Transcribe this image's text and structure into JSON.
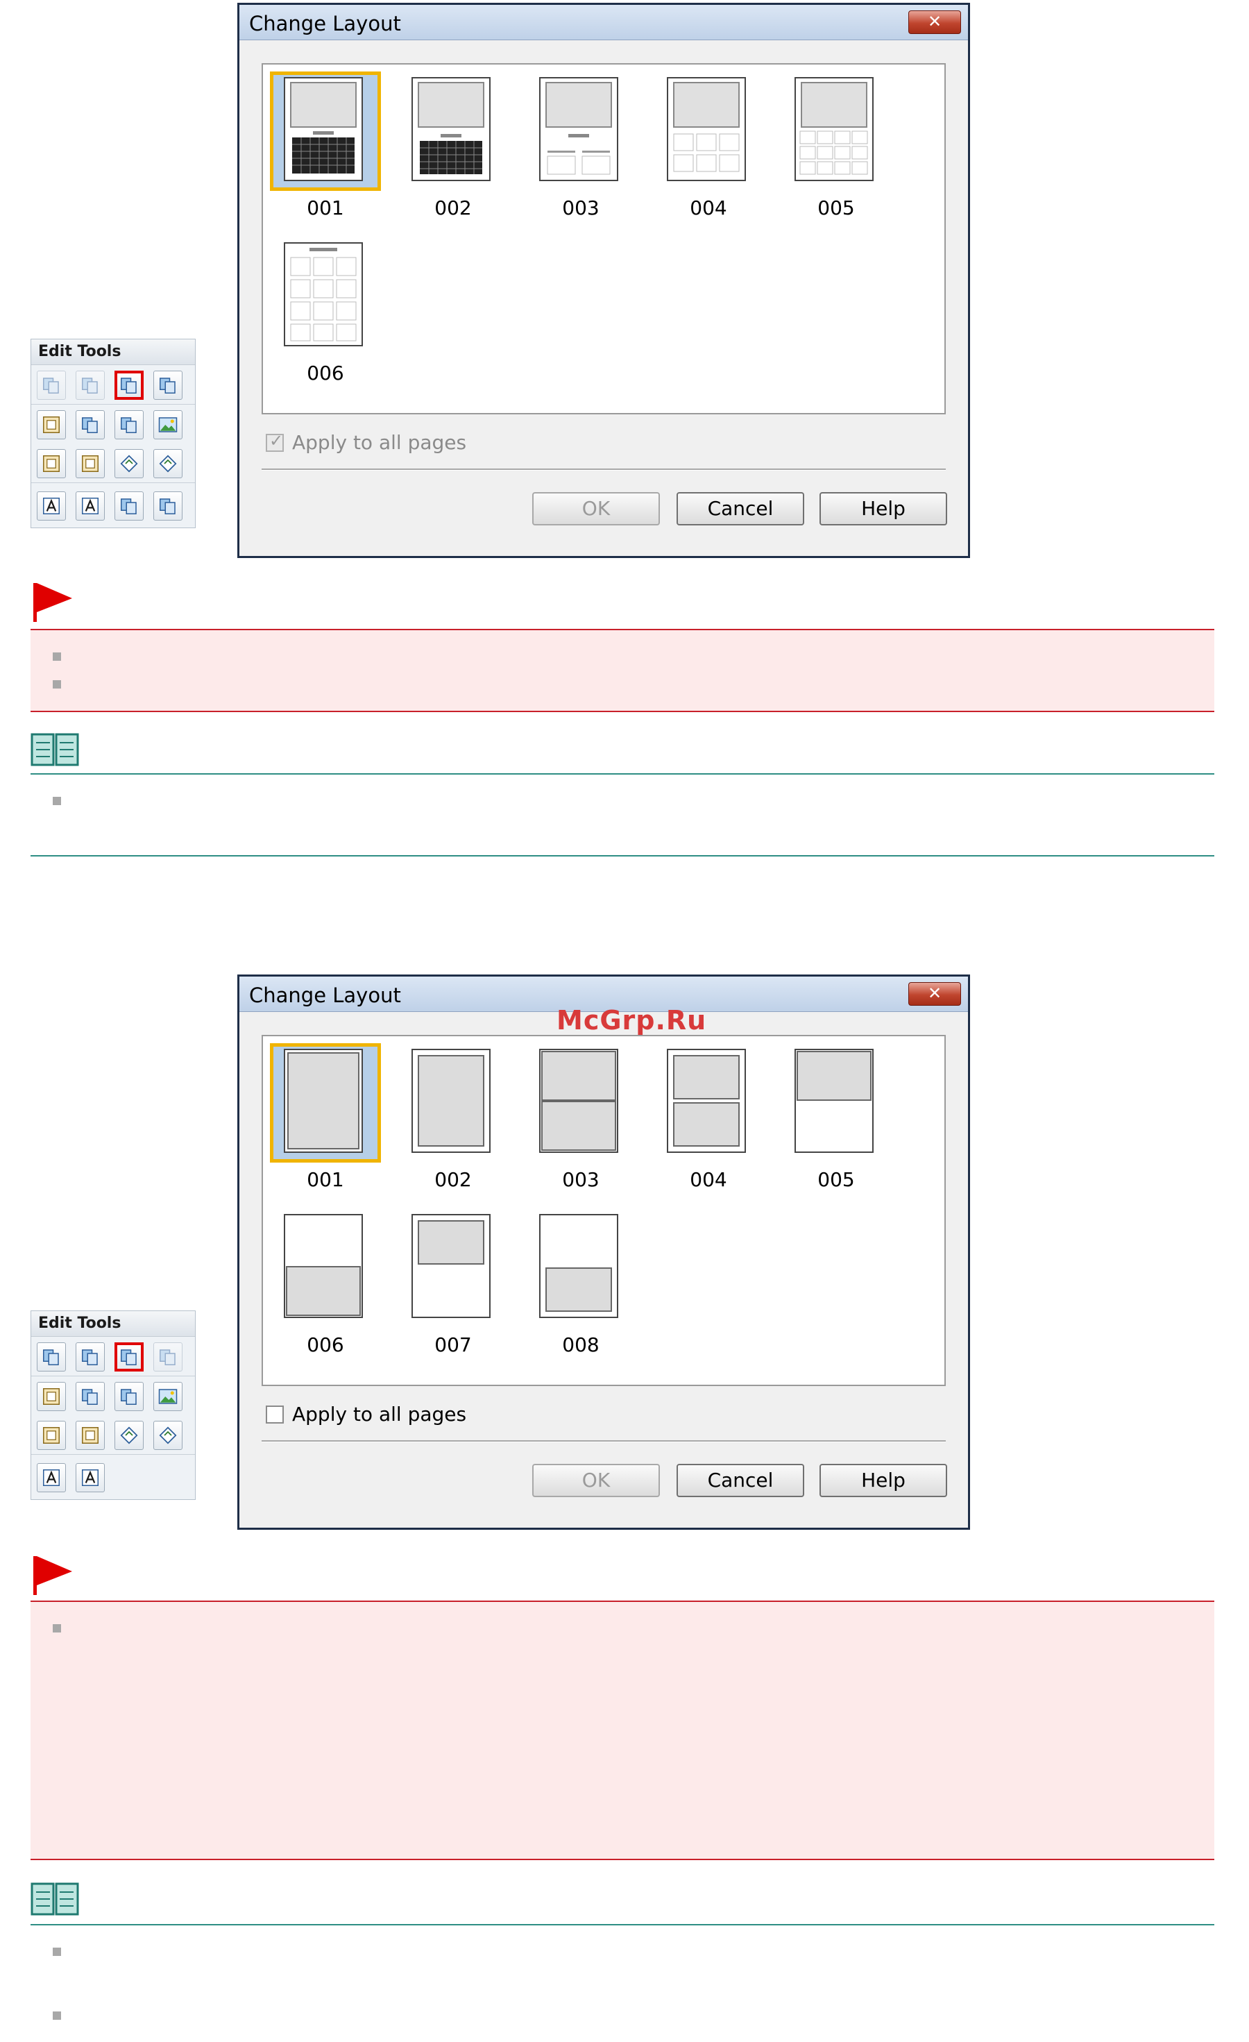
{
  "watermark": "McGrp.Ru",
  "section1": {
    "palette": {
      "title": "Edit  Tools"
    },
    "dialog": {
      "title": "Change Layout",
      "close_glyph": "✕",
      "layouts": [
        {
          "label": "001",
          "selected": true
        },
        {
          "label": "002",
          "selected": false
        },
        {
          "label": "003",
          "selected": false
        },
        {
          "label": "004",
          "selected": false
        },
        {
          "label": "005",
          "selected": false
        },
        {
          "label": "006",
          "selected": false
        }
      ],
      "apply_all": {
        "label": "Apply to all pages",
        "checked": true,
        "disabled": true
      },
      "ok_label": "OK",
      "cancel_label": "Cancel",
      "help_label": "Help"
    }
  },
  "section2": {
    "palette": {
      "title": "Edit  Tools"
    },
    "dialog": {
      "title": "Change Layout",
      "close_glyph": "✕",
      "layouts": [
        {
          "label": "001",
          "selected": true
        },
        {
          "label": "002",
          "selected": false
        },
        {
          "label": "003",
          "selected": false
        },
        {
          "label": "004",
          "selected": false
        },
        {
          "label": "005",
          "selected": false
        },
        {
          "label": "006",
          "selected": false
        },
        {
          "label": "007",
          "selected": false
        },
        {
          "label": "008",
          "selected": false
        }
      ],
      "apply_all": {
        "label": "Apply to all pages",
        "checked": false,
        "disabled": false
      },
      "ok_label": "OK",
      "cancel_label": "Cancel",
      "help_label": "Help"
    }
  },
  "colors": {
    "caution_border": "#c8202a",
    "caution_bg": "#fdeaea",
    "note_border": "#2e8e84",
    "selection_border": "#f0b400",
    "highlight_red": "#e00000"
  }
}
